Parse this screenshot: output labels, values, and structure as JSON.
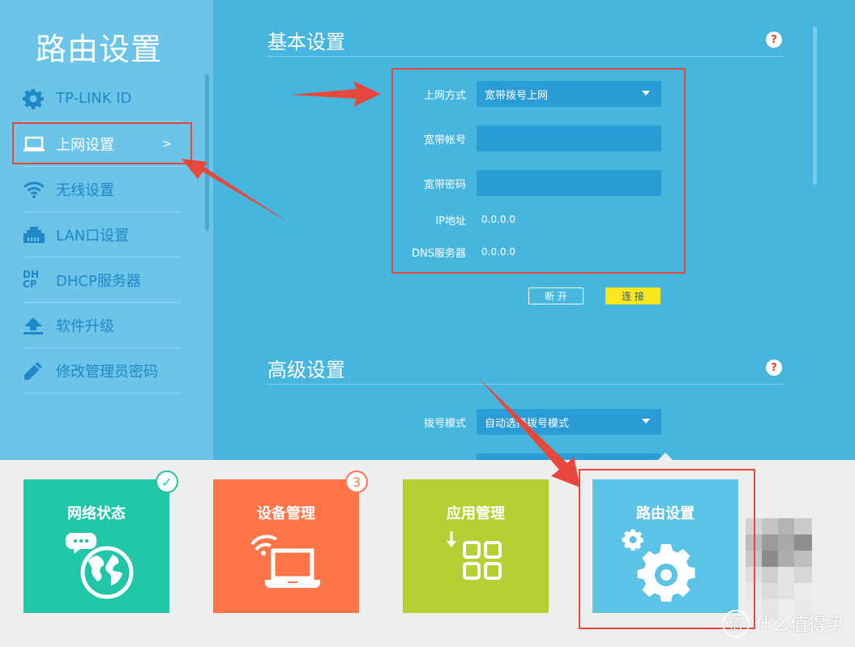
{
  "sidebar": {
    "title": "路由设置",
    "items": [
      {
        "label": "TP-LINK ID",
        "icon": "gear-icon"
      },
      {
        "label": "上网设置",
        "icon": "laptop-icon",
        "arrow": ">"
      },
      {
        "label": "无线设置",
        "icon": "wifi-icon"
      },
      {
        "label": "LAN口设置",
        "icon": "lan-port-icon"
      },
      {
        "label": "DHCP服务器",
        "icon": "dhcp-icon",
        "icon_text_top": "DH",
        "icon_text_bottom": "CP"
      },
      {
        "label": "软件升级",
        "icon": "upload-icon"
      },
      {
        "label": "修改管理员密码",
        "icon": "pencil-icon"
      }
    ]
  },
  "basic": {
    "title": "基本设置",
    "help": "?",
    "connection_type_label": "上网方式",
    "connection_type_value": "宽带拨号上网",
    "account_label": "宽带帐号",
    "account_value": "",
    "password_label": "宽带密码",
    "password_value": "",
    "ip_label": "IP地址",
    "ip_value": "0.0.0.0",
    "dns_label": "DNS服务器",
    "dns_value": "0.0.0.0",
    "disconnect_label": "断 开",
    "connect_label": "连 接"
  },
  "advanced": {
    "title": "高级设置",
    "help": "?",
    "dial_mode_label": "拨号模式",
    "dial_mode_value": "自动选择拨号模式"
  },
  "dock": [
    {
      "label": "网络状态",
      "color": "#1fc6a8",
      "badge": "✓"
    },
    {
      "label": "设备管理",
      "color": "#ff7548",
      "badge": "3"
    },
    {
      "label": "应用管理",
      "color": "#b8cf33"
    },
    {
      "label": "路由设置",
      "color": "#5bc3e6"
    }
  ],
  "colors": {
    "annotation_red": "#e8473c",
    "sidebar_bg": "#6cc4e8",
    "main_bg": "#47b6df",
    "connect_yellow": "#f8e71c"
  },
  "watermark": {
    "text": "什么值得买",
    "icon": "值"
  }
}
